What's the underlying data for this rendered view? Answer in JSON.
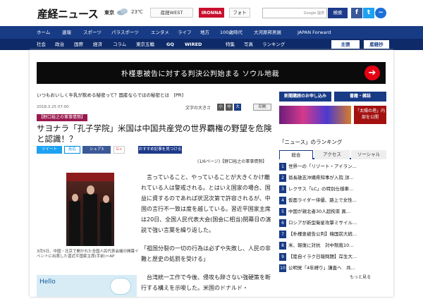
{
  "header": {
    "logo": "産経ニュース",
    "city": "東京",
    "temperature": "23℃",
    "pills": [
      "産経WEST",
      "IRONNA",
      "フォト"
    ],
    "search_hint": "Google 提供",
    "search_button": "検索"
  },
  "nav_primary": [
    "ホーム",
    "速報",
    "スポーツ",
    "パラスポーツ",
    "エンタメ",
    "ライフ",
    "地方",
    "100歳時代",
    "大河原邦男展",
    "JAPAN Forward"
  ],
  "nav_secondary": [
    "社会",
    "政治",
    "国際",
    "経済",
    "コラム",
    "東京五輪",
    "GQ",
    "WIRED",
    "特集",
    "写真",
    "ランキング"
  ],
  "nav_buttons": [
    "主張",
    "産経抄"
  ],
  "banner": {
    "text": "朴槿恵被告に対する判決公判始まる ソウル地裁"
  },
  "pr_line": "いつもおいしく牛乳が飲める秘密って？国産ならではの秘密とは　[PR]",
  "article": {
    "date": "2018.3.25 07:00",
    "font_size_label": "文字の大きさ",
    "font_sizes": [
      "小",
      "中",
      "大"
    ],
    "print_label": "印刷",
    "tag": "【野口裕之の軍事情勢】",
    "headline": "サヨナラ「孔子学院」米国は中国共産党の世界覇権の野望を危険と認識！？",
    "share": {
      "tweet": "ツイート",
      "hatena": "反応",
      "facebook": "シェア3",
      "gplus": "G+",
      "recommend": "おすすめ記事を見つける"
    },
    "page_info": "(1/6ページ)【野口裕之の軍事情勢】",
    "photo_caption": "3月5日、中国・北京で開かれた全国人民代表会議の開幕イベントに出席した習近平国家主席(手前)＝AP",
    "paragraphs": [
      "言っていること、やっていることが大きくかけ離れている人は警戒される。とはいえ国家の場合、国益に資するのであれば状況次第で許容されるが、中国の言行不一致は度を越している。習近平国家主席は20日、全国人民代表大会(国会に相当)閉幕日の演説で強い言葉を繰り返した。",
      "「祖国分裂の一切の行為は必ずや失敗し、人民の非難と歴史の処罰を受ける」",
      "台湾統一工作で今後、侵攻も辞さない強硬策を断行する構えを示唆した。米国のドナルド・"
    ],
    "ad_brand": "Hello"
  },
  "sidebar": {
    "buttons": [
      "新聞購読のお申し込み",
      "書籍・雑誌"
    ],
    "promo": "「太陽の塔」内部を公開",
    "ranking_title": "「ニュース」のランキング",
    "tabs": [
      "総合",
      "アクセス",
      "ソーシャル"
    ],
    "ranking": [
      {
        "rank": "1",
        "text": "世界一の「リゾート・アイラン..."
      },
      {
        "rank": "2",
        "text": "翁長雄志沖縄県知事が入院 詳..."
      },
      {
        "rank": "3",
        "text": "レクサス「LC」の特別仕様車..."
      },
      {
        "rank": "4",
        "text": "仮面ライダー俳優、路上で女性..."
      },
      {
        "rank": "5",
        "text": "中国が親北者30人超拘束 異..."
      },
      {
        "rank": "6",
        "text": "ロシアが新型衛星攻撃ミサイル..."
      },
      {
        "rank": "7",
        "text": "【朴槿恵被告公判】韓国前大統..."
      },
      {
        "rank": "8",
        "text": "米、報復に対抗　対中制裁10..."
      },
      {
        "rank": "9",
        "text": "【陸自イラク日報問題】岸生大..."
      },
      {
        "rank": "10",
        "text": "公明党「4年縛り」講査へ　共..."
      }
    ],
    "more": "もっと見る"
  },
  "colors": {
    "navy": "#183b86",
    "accent_red": "#e60012",
    "tag": "#9a1a4f"
  }
}
